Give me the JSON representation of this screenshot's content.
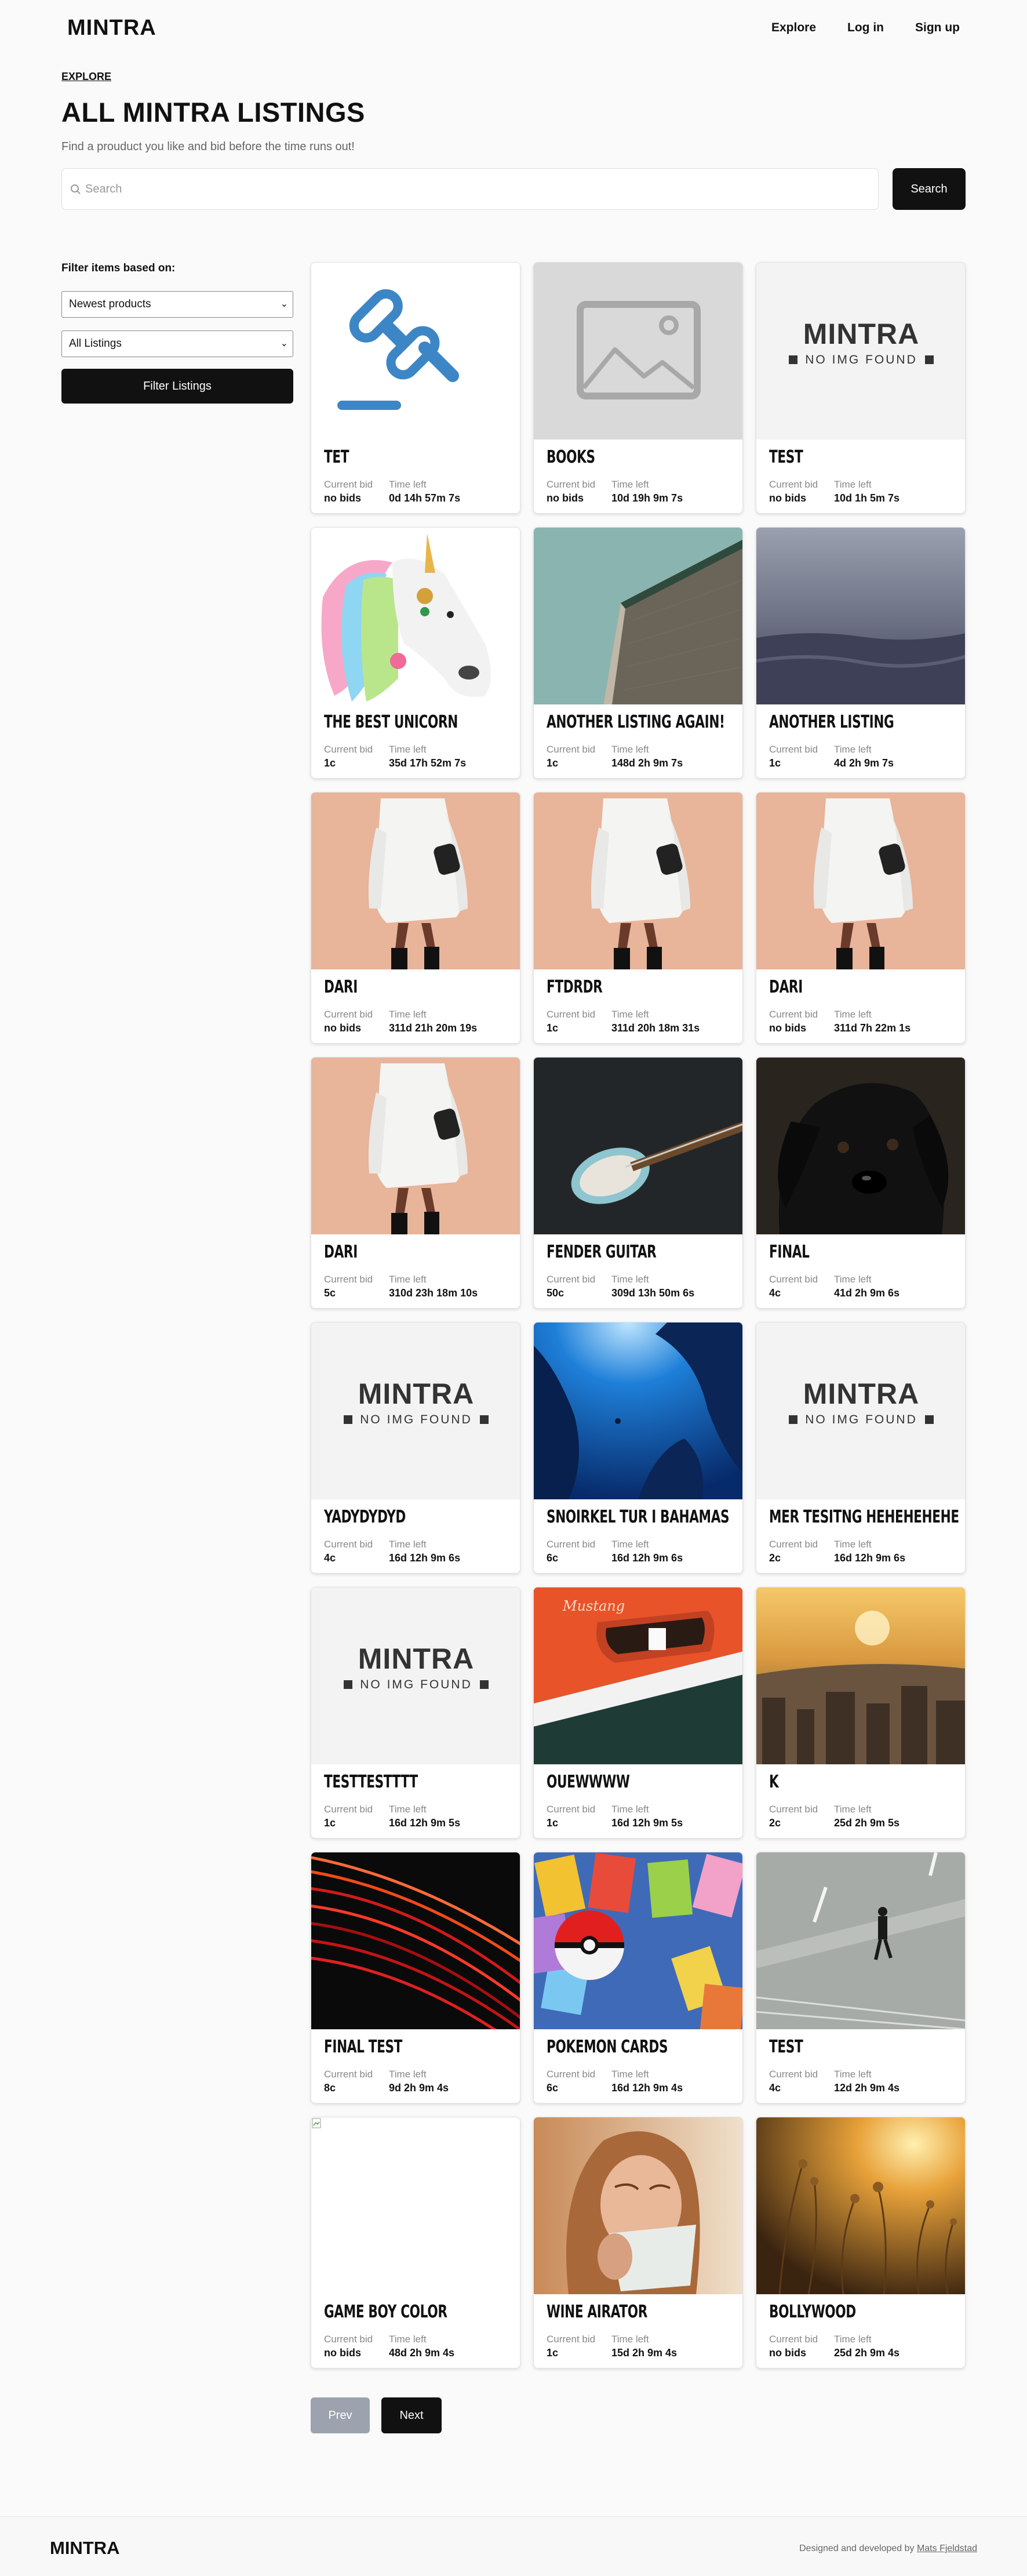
{
  "nav": {
    "logo": "MINTRA",
    "links": [
      "Explore",
      "Log in",
      "Sign up"
    ]
  },
  "breadcrumb": "EXPLORE",
  "title": "ALL MINTRA LISTINGS",
  "subtitle": "Find a prouduct you like and bid before the time runs out!",
  "search": {
    "placeholder": "Search",
    "button": "Search"
  },
  "filter": {
    "label": "Filter items based on:",
    "sort_selected": "Newest products",
    "scope_selected": "All Listings",
    "button": "Filter Listings"
  },
  "labels": {
    "current_bid": "Current bid",
    "time_left": "Time left"
  },
  "no_img": {
    "brand": "MINTRA",
    "text": "NO IMG FOUND"
  },
  "listings": [
    {
      "title": "TET",
      "bid": "no bids",
      "time": "0d 14h 57m 7s",
      "image": "gavel"
    },
    {
      "title": "BOOKS",
      "bid": "no bids",
      "time": "10d 19h 9m 7s",
      "image": "placeholder"
    },
    {
      "title": "TEST",
      "bid": "no bids",
      "time": "10d 1h 5m 7s",
      "image": "noimg"
    },
    {
      "title": "THE BEST UNICORN",
      "bid": "1c",
      "time": "35d 17h 52m 7s",
      "image": "unicorn"
    },
    {
      "title": "ANOTHER LISTING AGAIN!",
      "bid": "1c",
      "time": "148d 2h 9m 7s",
      "image": "building"
    },
    {
      "title": "ANOTHER LISTING",
      "bid": "1c",
      "time": "4d 2h 9m 7s",
      "image": "sea"
    },
    {
      "title": "DARI",
      "bid": "no bids",
      "time": "311d 21h 20m 19s",
      "image": "fashion"
    },
    {
      "title": "FTDRDR",
      "bid": "1c",
      "time": "311d 20h 18m 31s",
      "image": "fashion"
    },
    {
      "title": "DARI",
      "bid": "no bids",
      "time": "311d 7h 22m 1s",
      "image": "fashion"
    },
    {
      "title": "DARI",
      "bid": "5c",
      "time": "310d 23h 18m 10s",
      "image": "fashion"
    },
    {
      "title": "FENDER GUITAR",
      "bid": "50c",
      "time": "309d 13h 50m 6s",
      "image": "guitar"
    },
    {
      "title": "FINAL",
      "bid": "4c",
      "time": "41d 2h 9m 6s",
      "image": "dog"
    },
    {
      "title": "YADYDYDYD",
      "bid": "4c",
      "time": "16d 12h 9m 6s",
      "image": "noimg"
    },
    {
      "title": "SNOIRKEL TUR I BAHAMAS",
      "bid": "6c",
      "time": "16d 12h 9m 6s",
      "image": "underwater"
    },
    {
      "title": "MER TESITNG HEHEHEHEHE",
      "bid": "2c",
      "time": "16d 12h 9m 6s",
      "image": "noimg"
    },
    {
      "title": "TESTTESTTTT",
      "bid": "1c",
      "time": "16d 12h 9m 5s",
      "image": "noimg"
    },
    {
      "title": "OUEWWWW",
      "bid": "1c",
      "time": "16d 12h 9m 5s",
      "image": "car"
    },
    {
      "title": "K",
      "bid": "2c",
      "time": "25d 2h 9m 5s",
      "image": "city"
    },
    {
      "title": "FINAL TEST",
      "bid": "8c",
      "time": "9d 2h 9m 4s",
      "image": "lights"
    },
    {
      "title": "POKEMON CARDS",
      "bid": "6c",
      "time": "16d 12h 9m 4s",
      "image": "pokemon"
    },
    {
      "title": "TEST",
      "bid": "4c",
      "time": "12d 2h 9m 4s",
      "image": "road"
    },
    {
      "title": "GAME BOY COLOR",
      "bid": "no bids",
      "time": "48d 2h 9m 4s",
      "image": "broken"
    },
    {
      "title": "WINE AIRATOR",
      "bid": "1c",
      "time": "15d 2h 9m 4s",
      "image": "woman"
    },
    {
      "title": "BOLLYWOOD",
      "bid": "no bids",
      "time": "25d 2h 9m 4s",
      "image": "field"
    }
  ],
  "pagination": {
    "prev": "Prev",
    "next": "Next"
  },
  "footer": {
    "logo": "MINTRA",
    "credit_prefix": "Designed and developed by ",
    "credit_name": "Mats Fjeldstad"
  }
}
